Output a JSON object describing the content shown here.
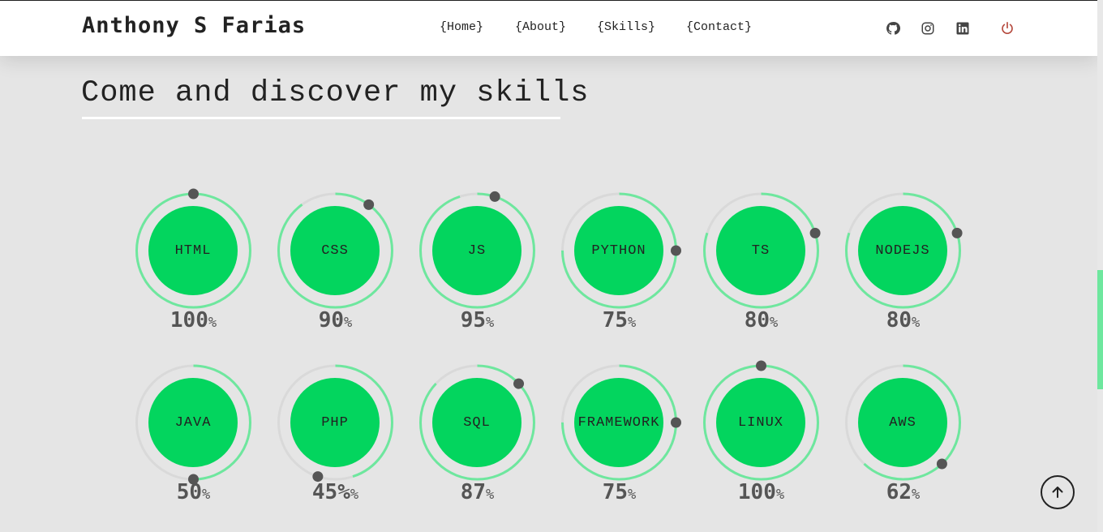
{
  "header": {
    "brand": "Anthony S Farias",
    "nav": [
      "{Home}",
      "{About}",
      "{Skills}",
      "{Contact}"
    ],
    "social": [
      {
        "icon": "github-icon"
      },
      {
        "icon": "instagram-icon"
      },
      {
        "icon": "linkedin-icon"
      },
      {
        "icon": "power-icon",
        "color": "#b5483c"
      }
    ]
  },
  "section": {
    "title": "Come and discover my skills"
  },
  "skills": [
    {
      "name": "HTML",
      "value": 100,
      "percent_text": "100"
    },
    {
      "name": "CSS",
      "value": 90,
      "percent_text": "90"
    },
    {
      "name": "JS",
      "value": 95,
      "percent_text": "95"
    },
    {
      "name": "PYTHON",
      "value": 75,
      "percent_text": "75"
    },
    {
      "name": "TS",
      "value": 80,
      "percent_text": "80"
    },
    {
      "name": "NODEJS",
      "value": 80,
      "percent_text": "80"
    },
    {
      "name": "JAVA",
      "value": 50,
      "percent_text": "50"
    },
    {
      "name": "PHP",
      "value": 45,
      "percent_text": "45%"
    },
    {
      "name": "SQL",
      "value": 87,
      "percent_text": "87"
    },
    {
      "name": "FRAMEWORK",
      "value": 75,
      "percent_text": "75"
    },
    {
      "name": "LINUX",
      "value": 100,
      "percent_text": "100"
    },
    {
      "name": "AWS",
      "value": 62,
      "percent_text": "62"
    }
  ],
  "percent_symbol": "%",
  "colors": {
    "accent": "#03d55e",
    "ring_progress": "#6ee79e",
    "ring_track": "#d9d9d9",
    "knob": "#555555",
    "background": "#e5e5e5"
  },
  "back_to_top": {
    "icon": "arrow-up-icon"
  }
}
